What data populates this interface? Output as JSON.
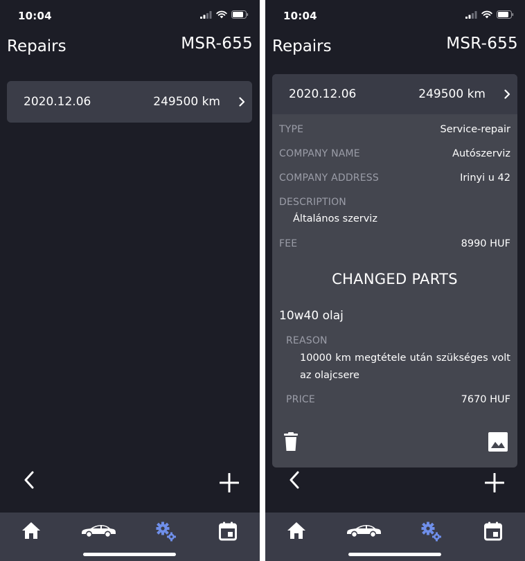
{
  "status": {
    "time": "10:04"
  },
  "header": {
    "title": "Repairs",
    "plate": "MSR-655"
  },
  "repair": {
    "date": "2020.12.06",
    "km": "249500 km"
  },
  "details": {
    "type_label": "TYPE",
    "type_value": "Service-repair",
    "company_name_label": "COMPANY NAME",
    "company_name_value": "Autószerviz",
    "company_address_label": "COMPANY ADDRESS",
    "company_address_value": "Irinyi u 42",
    "description_label": "DESCRIPTION",
    "description_value": "Általános szerviz",
    "fee_label": "FEE",
    "fee_value": "8990 HUF"
  },
  "changed_parts": {
    "title": "CHANGED PARTS",
    "parts": [
      {
        "name": "10w40 olaj",
        "reason_label": "REASON",
        "reason_value": "10000 km megtétele után szükséges volt az olajcsere",
        "price_label": "PRICE",
        "price_value": "7670 HUF"
      }
    ]
  },
  "icons": {
    "back": "chevron-left-icon",
    "add": "plus-icon",
    "delete": "trash-icon",
    "image": "image-icon",
    "tabs": [
      "home-icon",
      "car-icon",
      "gears-icon",
      "calendar-icon"
    ]
  },
  "colors": {
    "background": "#1c1d26",
    "card": "#3b3d48",
    "expanded_card": "#44464f",
    "tabbar": "#3a3c48",
    "active_tab": "#6f8fea",
    "label": "#9b9da8"
  }
}
